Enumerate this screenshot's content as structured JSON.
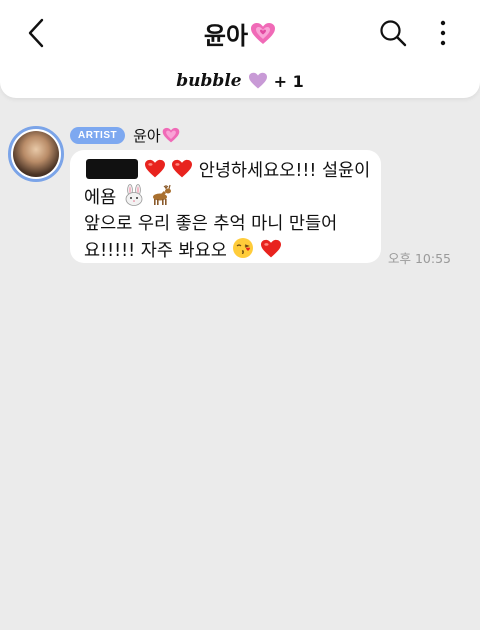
{
  "header": {
    "title": "윤아",
    "title_emoji": "heart-icon",
    "bubble_label": "bubble",
    "bubble_count": "+ 1"
  },
  "message": {
    "badge": "ARTIST",
    "sender": "윤아",
    "line1_text": "안녕하세요오!!! 설윤이",
    "line2_text": "에욤",
    "line3_text": "앞으로 우리 좋은 추억 마니 만들어",
    "line4_text": "요!!!!! 자주 봐요오",
    "time": "오후 10:55"
  },
  "colors": {
    "background": "#ebebeb",
    "badge": "#7da8f0",
    "avatar_ring": "#7ba4e8",
    "heart_red": "#e8231e",
    "heart_pink": "#f06ab7"
  }
}
